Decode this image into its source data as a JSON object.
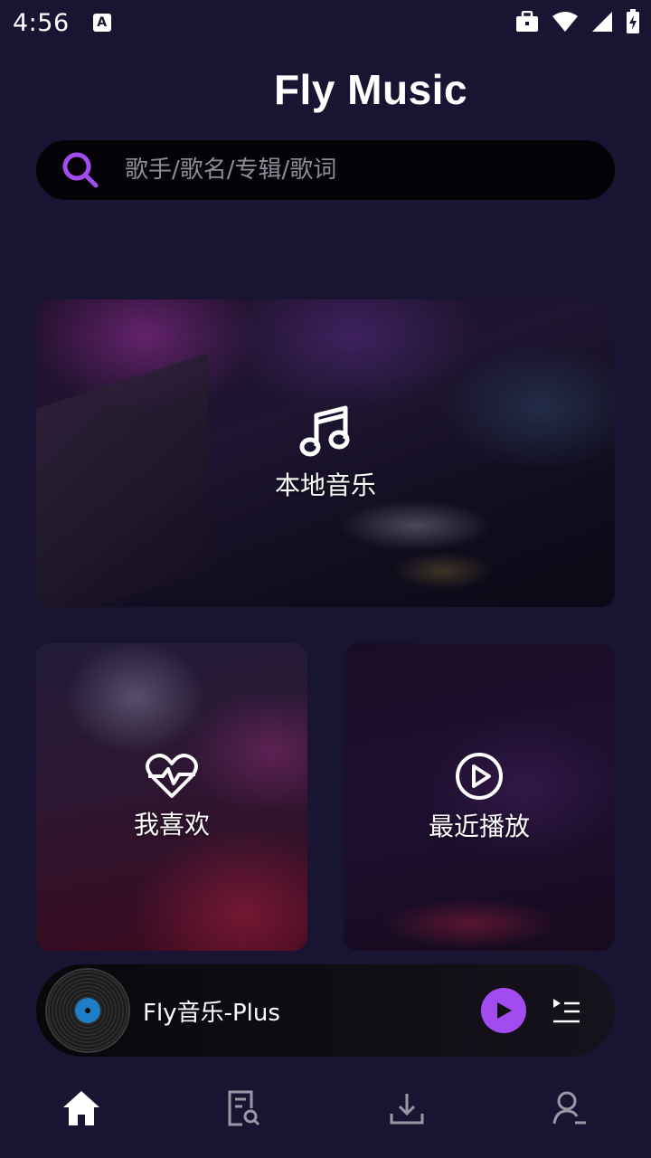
{
  "status_bar": {
    "time": "4:56",
    "a_badge": "A"
  },
  "header": {
    "title": "Fly Music"
  },
  "search": {
    "placeholder": "歌手/歌名/专辑/歌词"
  },
  "cards": {
    "local": {
      "label": "本地音乐",
      "icon": "music-note-icon"
    },
    "favorites": {
      "label": "我喜欢",
      "icon": "heart-pulse-icon"
    },
    "recent": {
      "label": "最近播放",
      "icon": "play-circle-icon"
    }
  },
  "player": {
    "title": "Fly音乐-Plus",
    "accent_color": "#a24cf0"
  },
  "bottom_nav": {
    "items": [
      {
        "name": "home",
        "icon": "home-icon",
        "active": true
      },
      {
        "name": "search-doc",
        "icon": "document-search-icon",
        "active": false
      },
      {
        "name": "download",
        "icon": "download-icon",
        "active": false
      },
      {
        "name": "profile",
        "icon": "user-icon",
        "active": false
      }
    ]
  },
  "colors": {
    "background": "#1a1433",
    "accent": "#a24cf0"
  }
}
